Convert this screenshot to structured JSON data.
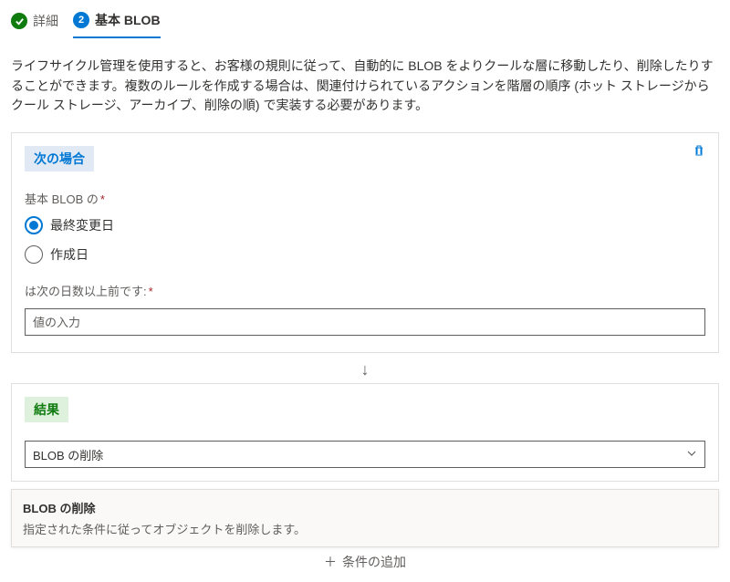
{
  "tabs": {
    "details": {
      "label": "詳細"
    },
    "base": {
      "label": "基本 BLOB",
      "num": "2"
    }
  },
  "description": "ライフサイクル管理を使用すると、お客様の規則に従って、自動的に BLOB をよりクールな層に移動したり、削除したりすることができます。複数のルールを作成する場合は、関連付けられているアクションを階層の順序 (ホット ストレージからクール ストレージ、アーカイブ、削除の順) で実装する必要があります。",
  "condition": {
    "section_title": "次の場合",
    "field_label": "基本 BLOB の",
    "radios": {
      "last_modified": "最終変更日",
      "created": "作成日"
    },
    "days_label": "は次の日数以上前です:",
    "days_placeholder": "値の入力"
  },
  "result": {
    "section_title": "結果",
    "select_value": "BLOB の削除",
    "tooltip_title": "BLOB の削除",
    "tooltip_desc": "指定された条件に従ってオブジェクトを削除します。"
  },
  "add_condition": "条件の追加"
}
